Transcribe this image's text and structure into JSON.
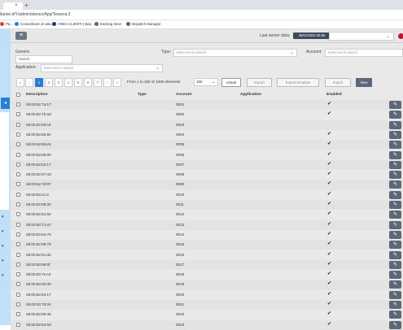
{
  "browser": {
    "tab_close": "×",
    "new_tab": "+",
    "url": "ilarion.it/Y/admin/elenco/App/Tessera.3",
    "bookmarks": [
      {
        "label": "Pa...",
        "color": "#d64541"
      },
      {
        "label": "Convertitore di valu...",
        "color": "#2a7fd4"
      },
      {
        "label": "AREA CLIENTI | Ban...",
        "color": "#1a3d6b"
      },
      {
        "label": "tracking timer",
        "color": "#666666"
      },
      {
        "label": "Dispatch Manager",
        "color": "#666666"
      }
    ]
  },
  "appbar": {
    "menu_icon": "≡",
    "last_server_label": "Last server data:",
    "last_server_value": "25/01/2022 06:58",
    "select_chevron": "⌄"
  },
  "filters": {
    "generic_label": "Generic",
    "search_label": "Search",
    "type_label": "Type:",
    "type_placeholder": "Enter text to search",
    "account_label": "Account:",
    "account_placeholder": "Enter text to search",
    "application_label": "Application:",
    "application_placeholder": "Enter text to search",
    "chevron": "⌄"
  },
  "pagination": {
    "first": "«",
    "prev": "‹",
    "pages": [
      "1",
      "2",
      "3",
      "4",
      "5",
      "6",
      "7"
    ],
    "next": "›",
    "last": "»",
    "active_page": "1",
    "range_text": "From 1 to 150 of 1000 elements",
    "per_page": "150",
    "per_page_chevron": "⌄"
  },
  "actions": {
    "reload": "reload",
    "export": "Export",
    "export_template": "Export template",
    "import": "Import",
    "new": "New"
  },
  "table": {
    "columns": [
      "Description",
      "Type",
      "Account",
      "Application",
      "Enabled"
    ],
    "rows": [
      {
        "description": "0d:00:62:7a:17",
        "account": "0001",
        "enabled": true
      },
      {
        "description": "0d:00:62:7b:ad",
        "account": "0002",
        "enabled": true
      },
      {
        "description": "0d:00:62:60:c8",
        "account": "0003",
        "enabled": false
      },
      {
        "description": "0d:00:62:8a:9e",
        "account": "0004",
        "enabled": true
      },
      {
        "description": "0d:00:62:8d:e5",
        "account": "0005",
        "enabled": true
      },
      {
        "description": "0d:00:62:5b:80",
        "account": "0006",
        "enabled": true
      },
      {
        "description": "0d:00:62:b2:17",
        "account": "0007",
        "enabled": true
      },
      {
        "description": "0d:00:62:67:43",
        "account": "0008",
        "enabled": true
      },
      {
        "description": "0d:00:62:7d:97",
        "account": "0009",
        "enabled": true
      },
      {
        "description": "0d:00:62:ec:3",
        "account": "0010",
        "enabled": true
      },
      {
        "description": "0d:00:62:68:30",
        "account": "0011",
        "enabled": true
      },
      {
        "description": "0d:00:62:51:92",
        "account": "0012",
        "enabled": true
      },
      {
        "description": "0d:00:62:71:a7",
        "account": "0013",
        "enabled": true
      },
      {
        "description": "0d:00:62:6a:76",
        "account": "0014",
        "enabled": true
      },
      {
        "description": "0d:00:62:99:78",
        "account": "0015",
        "enabled": true
      },
      {
        "description": "0d:00:62:51:d2",
        "account": "0016",
        "enabled": true
      },
      {
        "description": "0d:00:62:88:8f",
        "account": "0017",
        "enabled": true
      },
      {
        "description": "0d:00:62:7e:c0",
        "account": "0018",
        "enabled": true
      },
      {
        "description": "0d:00:62:92:39",
        "account": "0019",
        "enabled": true
      },
      {
        "description": "0d:00:62:53:17",
        "account": "0020",
        "enabled": true
      },
      {
        "description": "0d:00:62:76:24",
        "account": "0021",
        "enabled": true
      },
      {
        "description": "0d:00:62:90:45",
        "account": "0022",
        "enabled": true
      },
      {
        "description": "0d:00:62:52:9d",
        "account": "0023",
        "enabled": true
      }
    ],
    "check_glyph": "✔",
    "edit_glyph": "✎"
  },
  "sidebar": {
    "toggle": "◂",
    "arrow": "▾"
  }
}
